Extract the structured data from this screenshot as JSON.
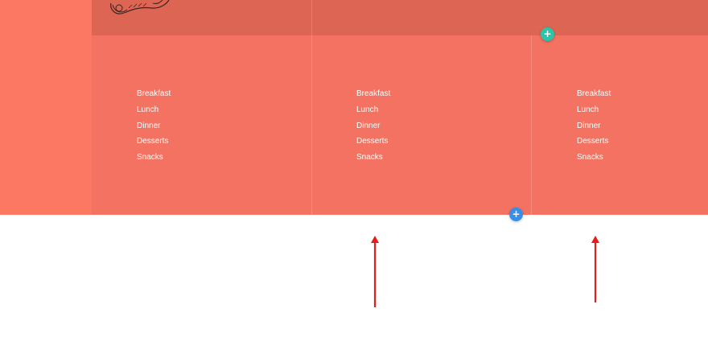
{
  "columns": [
    {
      "items": [
        "Breakfast",
        "Lunch",
        "Dinner",
        "Desserts",
        "Snacks"
      ]
    },
    {
      "items": [
        "Breakfast",
        "Lunch",
        "Dinner",
        "Desserts",
        "Snacks"
      ]
    },
    {
      "items": [
        "Breakfast",
        "Lunch",
        "Dinner",
        "Desserts",
        "Snacks"
      ]
    }
  ],
  "buttons": {
    "add_row": {
      "symbol": "+",
      "color": "#29c4a9"
    },
    "add_module": {
      "symbol": "+",
      "color": "#3a8ee6"
    }
  },
  "annotations": {
    "arrow_color": "#e51c1c"
  },
  "icons": {
    "sketch": "food-sketch-icon"
  }
}
